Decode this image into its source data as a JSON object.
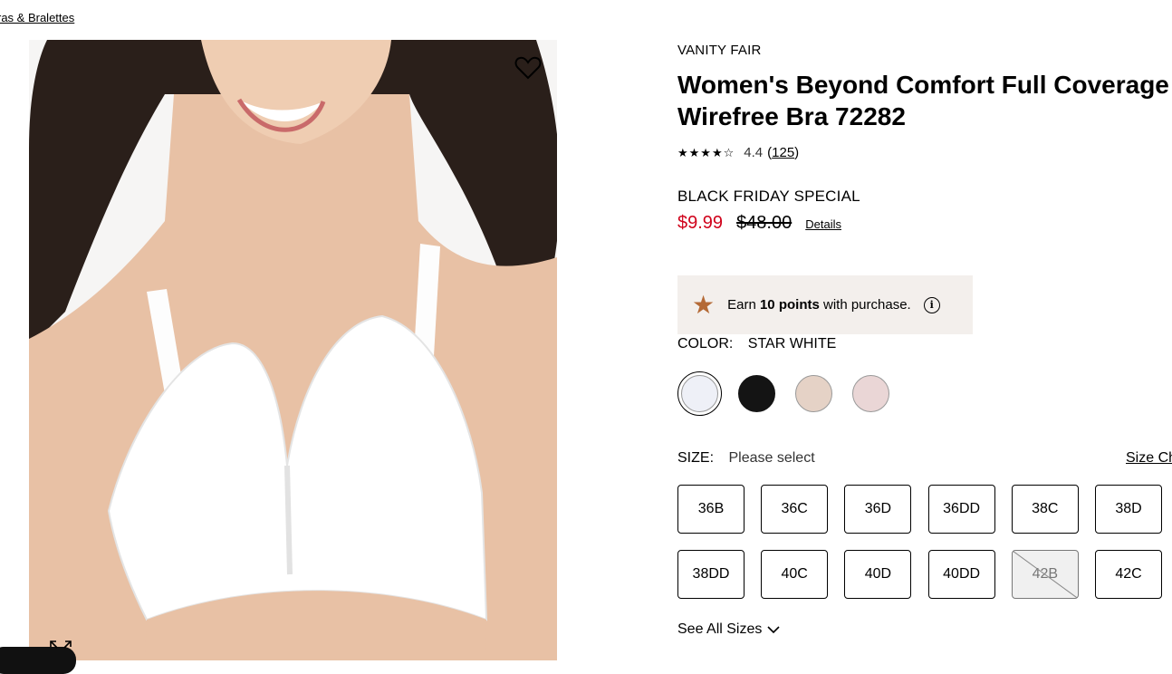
{
  "breadcrumb": {
    "label": "ras & Bralettes"
  },
  "product": {
    "brand": "VANITY FAIR",
    "title": "Women's Beyond Comfort Full Coverage Wirefree Bra 72282",
    "rating": {
      "stars_icon": "star-rating-icon",
      "value": "4.4",
      "open_paren": "(",
      "count": "125",
      "close_paren": ")",
      "stars_value": 4.4
    },
    "promo": "BLACK FRIDAY SPECIAL",
    "price": {
      "sale": "$9.99",
      "original": "$48.00",
      "details_link": "Details",
      "sale_color": "#d0021b"
    }
  },
  "points": {
    "prefix": "Earn ",
    "amount": "10 points",
    "suffix": " with purchase.",
    "icon": "star-icon",
    "info_icon": "info-icon",
    "icon_color": "#b46a36"
  },
  "color": {
    "label": "COLOR:",
    "selected": "STAR WHITE",
    "swatches": [
      {
        "color": "#eef0f7",
        "selected": true
      },
      {
        "color": "#141414",
        "selected": false
      },
      {
        "color": "#e5d2c6",
        "selected": false
      },
      {
        "color": "#ead6d6",
        "selected": false
      }
    ]
  },
  "size": {
    "label": "SIZE:",
    "value": "Please select",
    "chart_link": "Size Ch",
    "options": [
      {
        "label": "36B",
        "available": true
      },
      {
        "label": "36C",
        "available": true
      },
      {
        "label": "36D",
        "available": true
      },
      {
        "label": "36DD",
        "available": true
      },
      {
        "label": "38C",
        "available": true
      },
      {
        "label": "38D",
        "available": true
      },
      {
        "label": "38DD",
        "available": true
      },
      {
        "label": "40C",
        "available": true
      },
      {
        "label": "40D",
        "available": true
      },
      {
        "label": "40DD",
        "available": true
      },
      {
        "label": "42B",
        "available": false
      },
      {
        "label": "42C",
        "available": true
      }
    ],
    "see_all": "See All Sizes"
  },
  "icons": {
    "wishlist": "heart-icon",
    "expand": "expand-icon",
    "chevron": "chevron-down-icon"
  }
}
